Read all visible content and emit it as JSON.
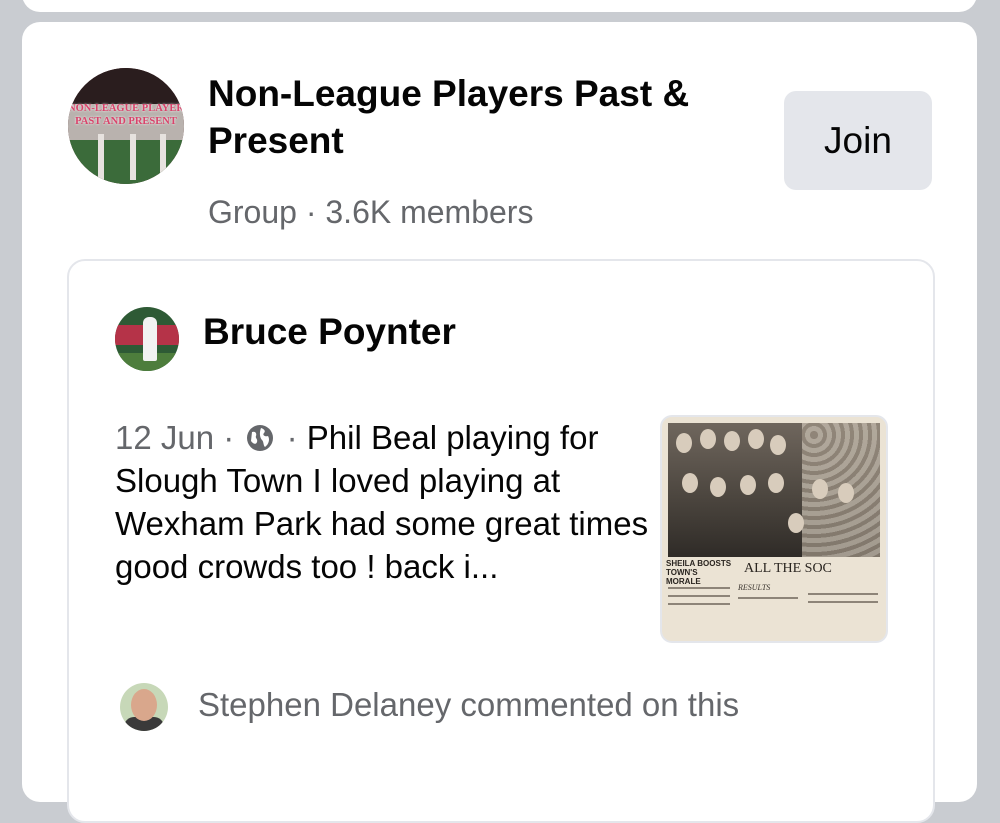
{
  "group": {
    "name": "Non-League Players Past & Present",
    "meta": "Group · 3.6K members",
    "avatar_text": "NON-LEAGUE PLAYER PAST AND PRESENT",
    "join_label": "Join"
  },
  "post": {
    "author": "Bruce Poynter",
    "date": "12 Jun",
    "separator": "·",
    "privacy_icon": "globe-icon",
    "text": "Phil Beal playing for Slough Town I loved playing at Wexham Park had some great times good crowds too ! back i...",
    "image": {
      "caption": "SHEILA BOOSTS TOWN'S MORALE",
      "headline": "ALL THE SOC",
      "results_label": "RESULTS"
    },
    "comment_activity": "Stephen Delaney commented on this"
  },
  "colors": {
    "background": "#c9ccd1",
    "card": "#ffffff",
    "secondary_text": "#65676b",
    "button_bg": "#e4e6eb"
  }
}
